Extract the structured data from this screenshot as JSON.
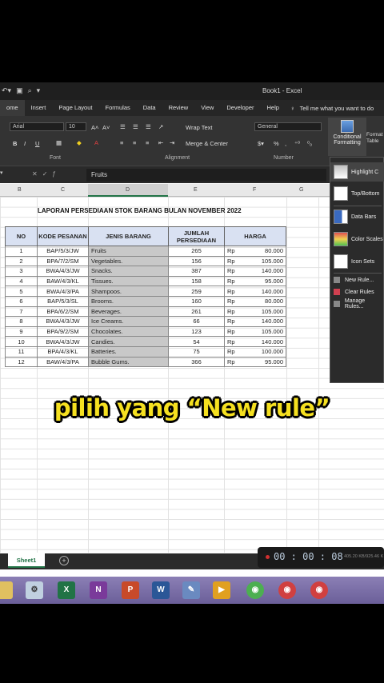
{
  "window": {
    "title": "Book1 - Excel"
  },
  "ribbon": {
    "tabs": [
      "ome",
      "Insert",
      "Page Layout",
      "Formulas",
      "Data",
      "Review",
      "View",
      "Developer",
      "Help"
    ],
    "tell_me": "Tell me what you want to do",
    "font_name": "Arial",
    "font_size": "10",
    "font_group": "Font",
    "alignment_group": "Alignment",
    "number_group": "Number",
    "wrap_text": "Wrap Text",
    "merge_center": "Merge & Center",
    "number_format": "General",
    "conditional_formatting": "Conditional Formatting",
    "format_table": "Format Table"
  },
  "formula_bar": {
    "content": "Fruits"
  },
  "columns": [
    "B",
    "C",
    "D",
    "E",
    "F",
    "G"
  ],
  "sheet": {
    "title": "LAPORAN PERSEDIAAN STOK BARANG BULAN NOVEMBER 2022",
    "headers": {
      "no": "NO",
      "kode": "KODE PESANAN",
      "jenis": "JENIS BARANG",
      "jumlah": "JUMLAH PERSEDIAAN",
      "harga": "HARGA"
    },
    "rows": [
      {
        "no": "1",
        "kode": "BAP/5/3/JW",
        "jenis": "Fruits",
        "jumlah": "265",
        "rp": "Rp",
        "harga": "80.000"
      },
      {
        "no": "2",
        "kode": "BPA/7/2/SM",
        "jenis": "Vegetables.",
        "jumlah": "156",
        "rp": "Rp",
        "harga": "105.000"
      },
      {
        "no": "3",
        "kode": "BWA/4/3/JW",
        "jenis": "Snacks.",
        "jumlah": "387",
        "rp": "Rp",
        "harga": "140.000"
      },
      {
        "no": "4",
        "kode": "BAW/4/3/KL",
        "jenis": "Tissues.",
        "jumlah": "158",
        "rp": "Rp",
        "harga": "95.000"
      },
      {
        "no": "5",
        "kode": "BWA/4/3/PA",
        "jenis": "Shampoos.",
        "jumlah": "259",
        "rp": "Rp",
        "harga": "140.000"
      },
      {
        "no": "6",
        "kode": "BAP/5/3/SL",
        "jenis": "Brooms.",
        "jumlah": "160",
        "rp": "Rp",
        "harga": "80.000"
      },
      {
        "no": "7",
        "kode": "BPA/6/2/SM",
        "jenis": "Beverages.",
        "jumlah": "261",
        "rp": "Rp",
        "harga": "105.000"
      },
      {
        "no": "8",
        "kode": "BWA/4/3/JW",
        "jenis": "Ice Creams.",
        "jumlah": "66",
        "rp": "Rp",
        "harga": "140.000"
      },
      {
        "no": "9",
        "kode": "BPA/9/2/SM",
        "jenis": "Chocolates.",
        "jumlah": "123",
        "rp": "Rp",
        "harga": "105.000"
      },
      {
        "no": "10",
        "kode": "BWA/4/3/JW",
        "jenis": "Candies.",
        "jumlah": "54",
        "rp": "Rp",
        "harga": "140.000"
      },
      {
        "no": "11",
        "kode": "BPA/4/3/KL",
        "jenis": "Batteries.",
        "jumlah": "75",
        "rp": "Rp",
        "harga": "100.000"
      },
      {
        "no": "12",
        "kode": "BAW/4/3/PA",
        "jenis": "Bubble Gums.",
        "jumlah": "366",
        "rp": "Rp",
        "harga": "95.000"
      }
    ]
  },
  "cf_menu": {
    "items": [
      "Highlight C",
      "Top/Bottom",
      "Data Bars",
      "Color Scales",
      "Icon Sets",
      "New Rule...",
      "Clear Rules",
      "Manage Rules..."
    ]
  },
  "caption": "pilih yang “New rule”",
  "sheet_tab": "Sheet1",
  "recorder": {
    "time": "00 : 00 : 08",
    "status": "405.20 KB/925.46 K"
  },
  "taskbar": {
    "apps": [
      "Excel",
      "OneNote",
      "PowerPoint",
      "Word"
    ]
  }
}
